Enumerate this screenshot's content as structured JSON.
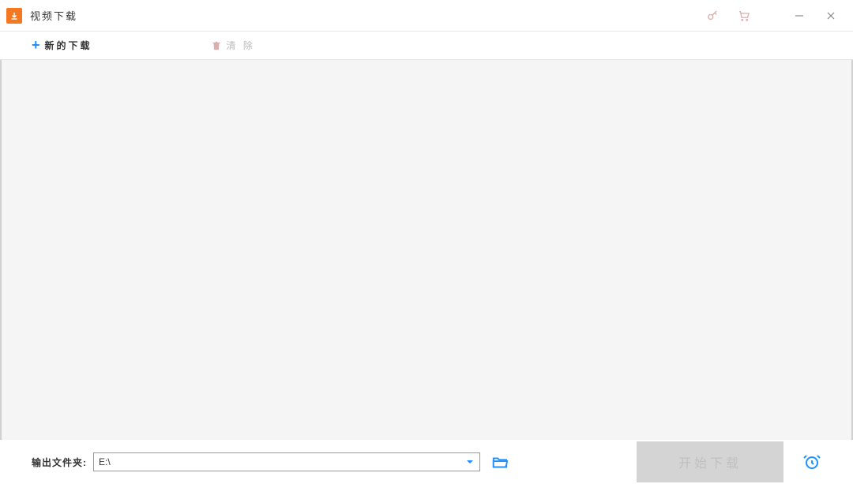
{
  "titlebar": {
    "title": "视频下载"
  },
  "toolbar": {
    "new_download_label": "新的下载",
    "clear_label": "清 除"
  },
  "footer": {
    "output_label": "输出文件夹:",
    "output_value": "E:\\",
    "start_button_label": "开始下载"
  }
}
